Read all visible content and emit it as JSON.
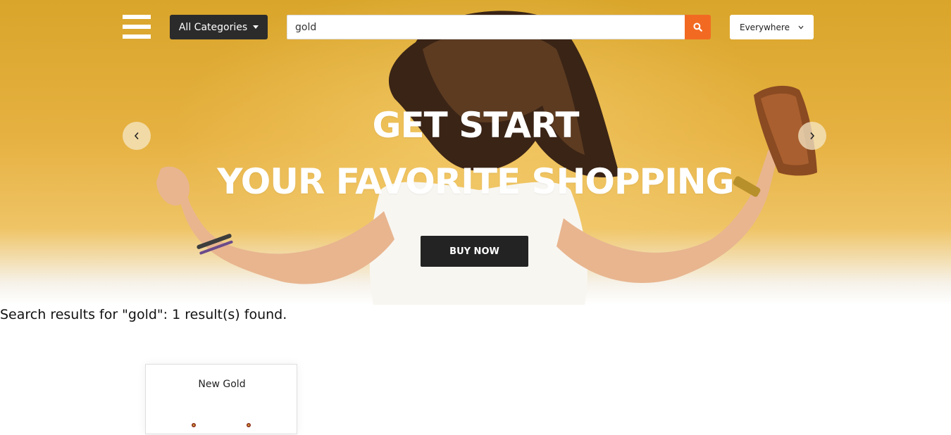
{
  "header": {
    "menu_icon": "hamburger-menu-icon",
    "category_label": "All Categories",
    "search_value": "gold",
    "search_icon": "search-icon",
    "location_label": "Everywhere",
    "accent_color": "#f26a22"
  },
  "hero": {
    "line1": "GET START",
    "line2": "YOUR FAVORITE SHOPPING",
    "cta_label": "BUY NOW",
    "prev_icon": "chevron-left-icon",
    "next_icon": "chevron-right-icon",
    "background_color": "#e6b141"
  },
  "results": {
    "summary": "Search results for \"gold\": 1 result(s) found.",
    "items": [
      {
        "title": "New Gold"
      }
    ]
  }
}
